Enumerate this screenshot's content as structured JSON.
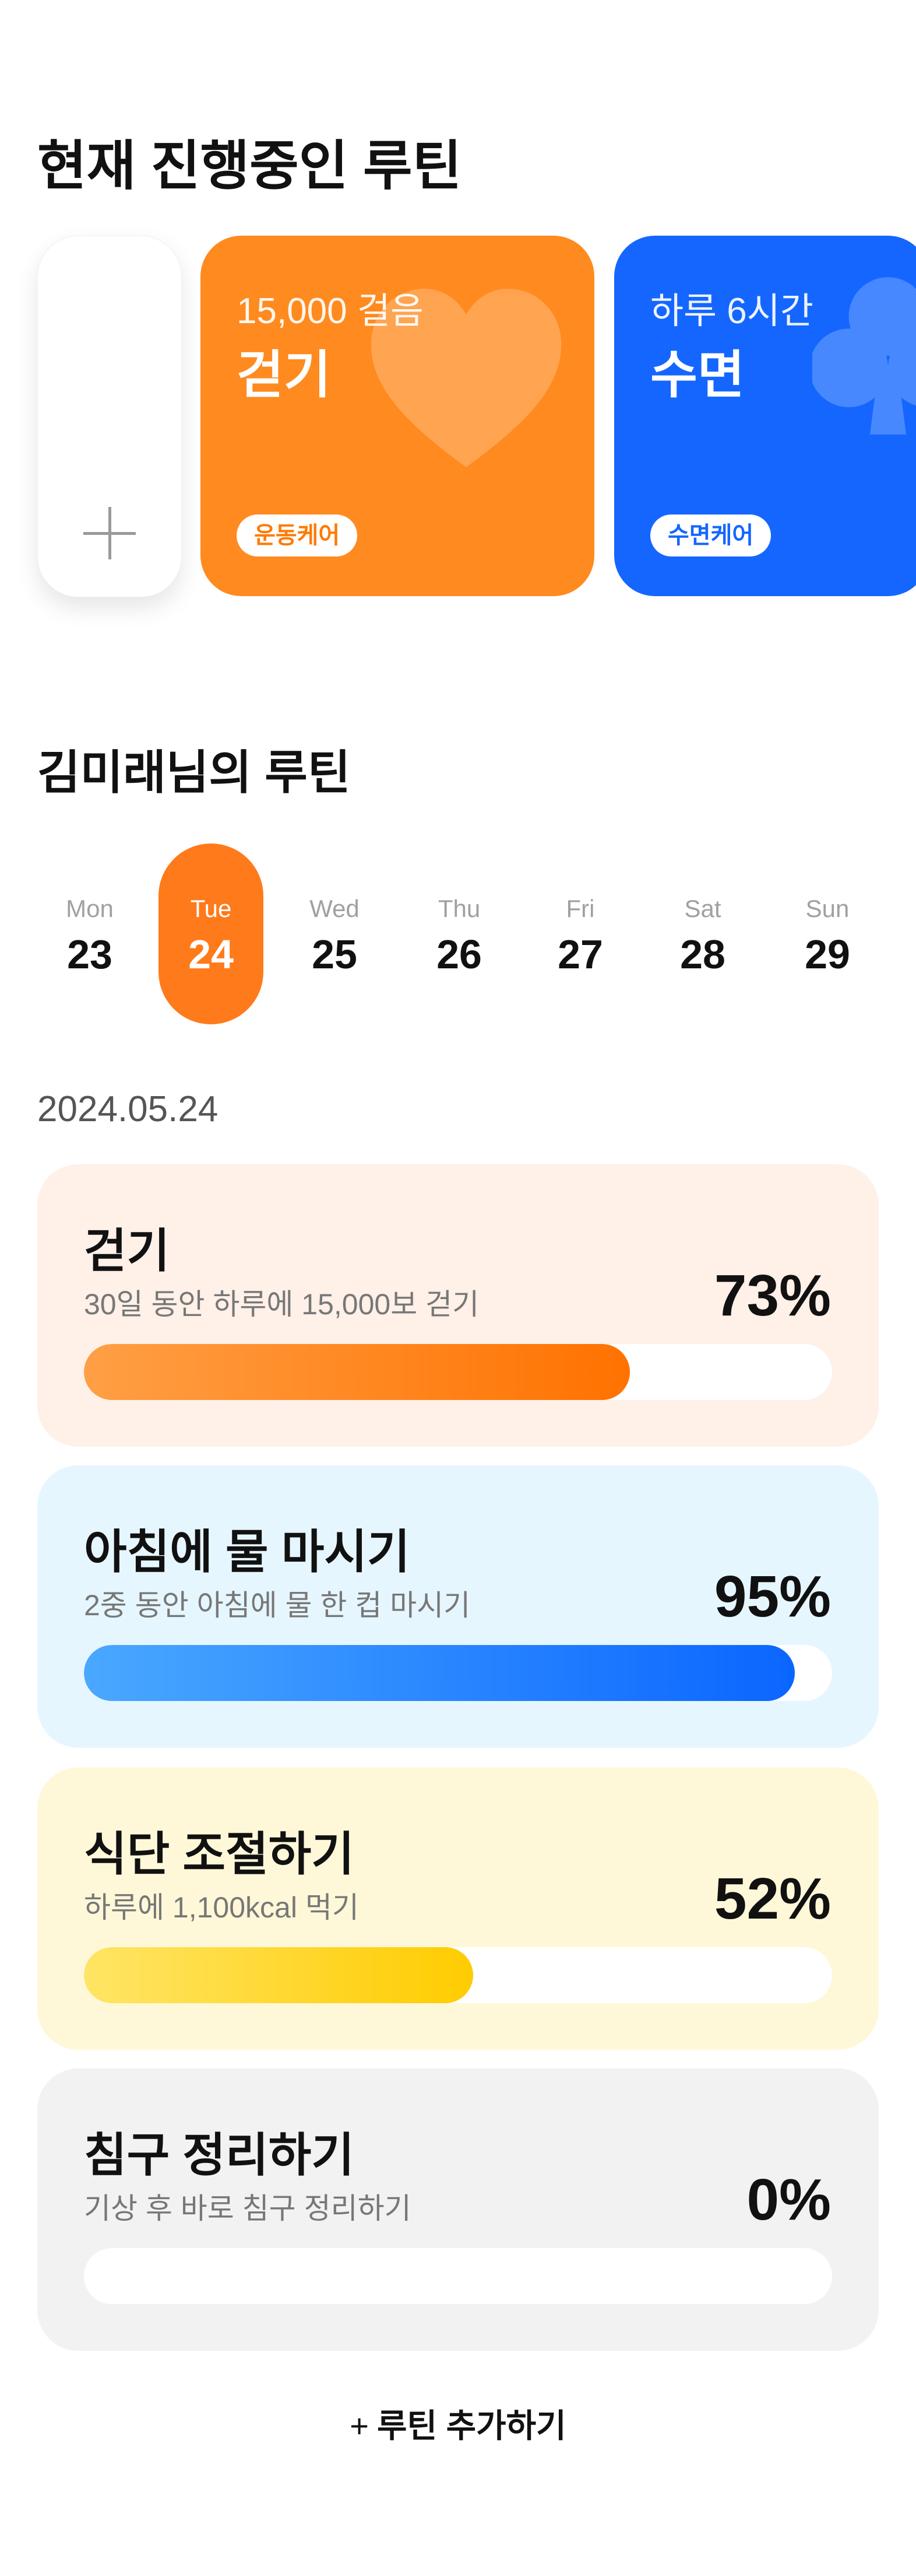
{
  "current": {
    "title": "현재 진행중인 루틴",
    "cards": [
      {
        "sub": "15,000 걸음",
        "main": "걷기",
        "tag": "운동케어",
        "icon": "heart-icon"
      },
      {
        "sub": "하루 6시간",
        "main": "수면",
        "tag": "수면케어",
        "icon": "club-icon"
      }
    ]
  },
  "my": {
    "title": "김미래님의 루틴"
  },
  "week": {
    "days": [
      {
        "name": "Mon",
        "num": "23"
      },
      {
        "name": "Tue",
        "num": "24",
        "selected": true
      },
      {
        "name": "Wed",
        "num": "25"
      },
      {
        "name": "Thu",
        "num": "26"
      },
      {
        "name": "Fri",
        "num": "27"
      },
      {
        "name": "Sat",
        "num": "28"
      },
      {
        "name": "Sun",
        "num": "29"
      }
    ]
  },
  "date": "2024.05.24",
  "routines": [
    {
      "title": "걷기",
      "desc": "30일 동안 하루에 15,000보 걷기",
      "percent_label": "73%",
      "progress": 0.73
    },
    {
      "title": "아침에 물 마시기",
      "desc": "2중 동안 아침에 물 한 컵 마시기",
      "percent_label": "95%",
      "progress": 0.95
    },
    {
      "title": "식단 조절하기",
      "desc": "하루에 1,100kcal 먹기",
      "percent_label": "52%",
      "progress": 0.52
    },
    {
      "title": "침구 정리하기",
      "desc": "기상 후 바로 침구 정리하기",
      "percent_label": "0%",
      "progress": 0
    }
  ],
  "add_routine": {
    "icon": "plus-icon",
    "label": "루틴 추가하기"
  },
  "colors": {
    "walk_card": "#ff8a20",
    "sleep_card": "#1466ff",
    "selected_day": "#ff7a1a"
  }
}
